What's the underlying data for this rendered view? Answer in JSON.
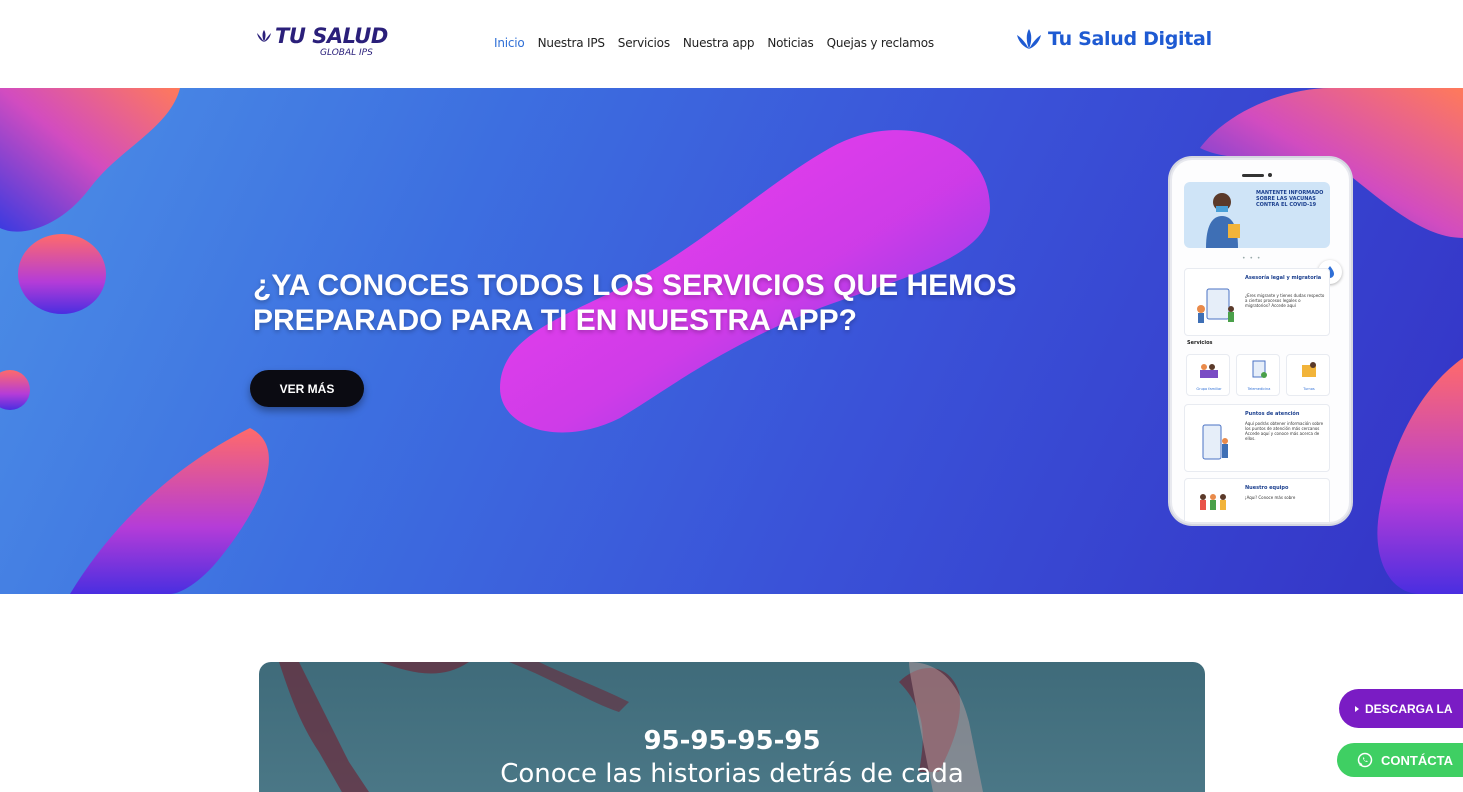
{
  "header": {
    "brand_main": "TU SALUD",
    "brand_sub": "GLOBAL IPS",
    "nav": [
      {
        "label": "Inicio",
        "active": true
      },
      {
        "label": "Nuestra IPS",
        "active": false
      },
      {
        "label": "Servicios",
        "active": false
      },
      {
        "label": "Nuestra app",
        "active": false
      },
      {
        "label": "Noticias",
        "active": false
      },
      {
        "label": "Quejas y reclamos",
        "active": false
      }
    ],
    "digital_label": "Tu Salud Digital"
  },
  "hero": {
    "title_line1": "¿YA CONOCES TODOS LOS SERVICIOS QUE HEMOS",
    "title_line2": "PREPARADO PARA TI EN NUESTRA APP?",
    "button_label": "VER MÁS"
  },
  "phone": {
    "banner_text": "MANTENTE INFORMADO SOBRE LAS VACUNAS CONTRA EL COVID-19",
    "card1_title": "Asesoría legal y migratoria",
    "card1_text": "¿Eres migrante y tienes dudas respecto a ciertos procesos legales o migratorios? Accede aquí",
    "section_label": "Servicios",
    "services": [
      "Grupo familiar",
      "Telemedicina",
      "Turnos"
    ],
    "card2_title": "Puntos de atención",
    "card2_text": "Aquí podrás obtener información sobre los puntos de atención más cercanos Accede aquí y conoce más acerca de ellos.",
    "card3_title": "Nuestro equipo",
    "card3_text": "¡Aquí! Conoce más sobre"
  },
  "promo": {
    "phone_number": "95-95-95-95",
    "subtitle": "Conoce las historias detrás de cada"
  },
  "floating": {
    "download_label": "DESCARGA LA",
    "contact_label": "CONTÁCTA"
  },
  "colors": {
    "brand_navy": "#2a1f7a",
    "nav_active": "#2f6fd6",
    "digital_blue": "#1e5ad2",
    "download_purple": "#7a1cc4",
    "contact_green": "#3fcf63"
  },
  "icons": {
    "brand": "lotus-icon",
    "digital": "lotus-icon",
    "download": "play-triangle-icon",
    "contact": "whatsapp-icon"
  }
}
